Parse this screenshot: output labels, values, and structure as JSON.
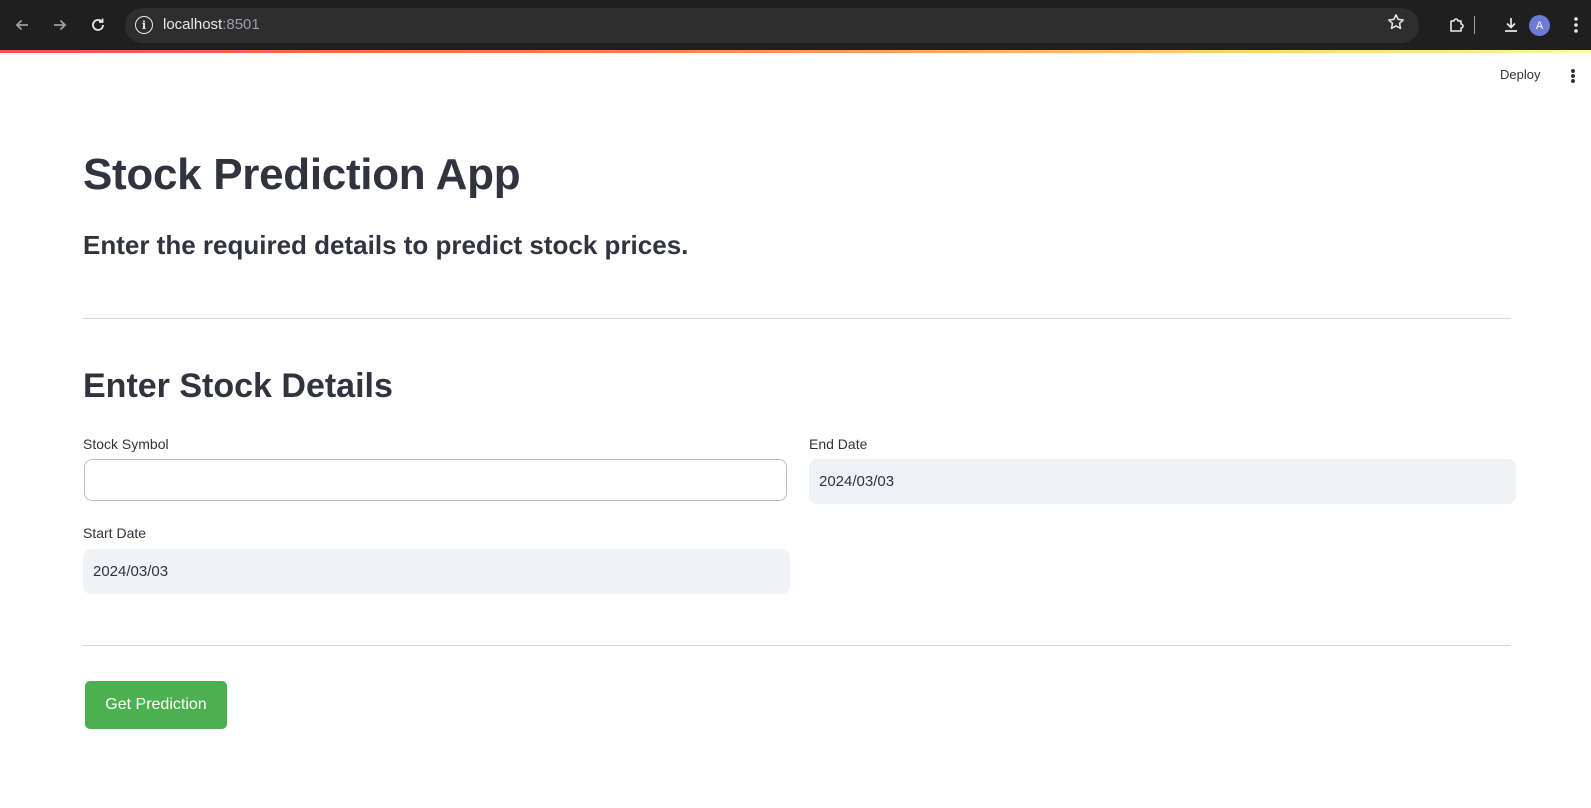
{
  "browser": {
    "url_host": "localhost",
    "url_port": ":8501",
    "icons": {
      "back": "arrow-left-icon",
      "forward": "arrow-right-icon",
      "reload": "reload-icon",
      "info": "info-icon",
      "star": "star-icon",
      "extensions": "puzzle-icon",
      "download": "download-icon",
      "menu": "vertical-dots-icon"
    },
    "avatar_initial": "A",
    "avatar_color": "#6e7ad8"
  },
  "header": {
    "deploy_label": "Deploy"
  },
  "main": {
    "title": "Stock Prediction App",
    "subtitle": "Enter the required details to predict stock prices.",
    "section_title": "Enter Stock Details",
    "fields": {
      "stock_symbol": {
        "label": "Stock Symbol",
        "value": ""
      },
      "end_date": {
        "label": "End Date",
        "value": "2024/03/03"
      },
      "start_date": {
        "label": "Start Date",
        "value": "2024/03/03"
      }
    },
    "predict_button_label": "Get Prediction"
  },
  "colors": {
    "text": "#31333f",
    "button": "#4caf50",
    "input_background": "#f0f2f6",
    "divider": "#d6d6d9"
  }
}
